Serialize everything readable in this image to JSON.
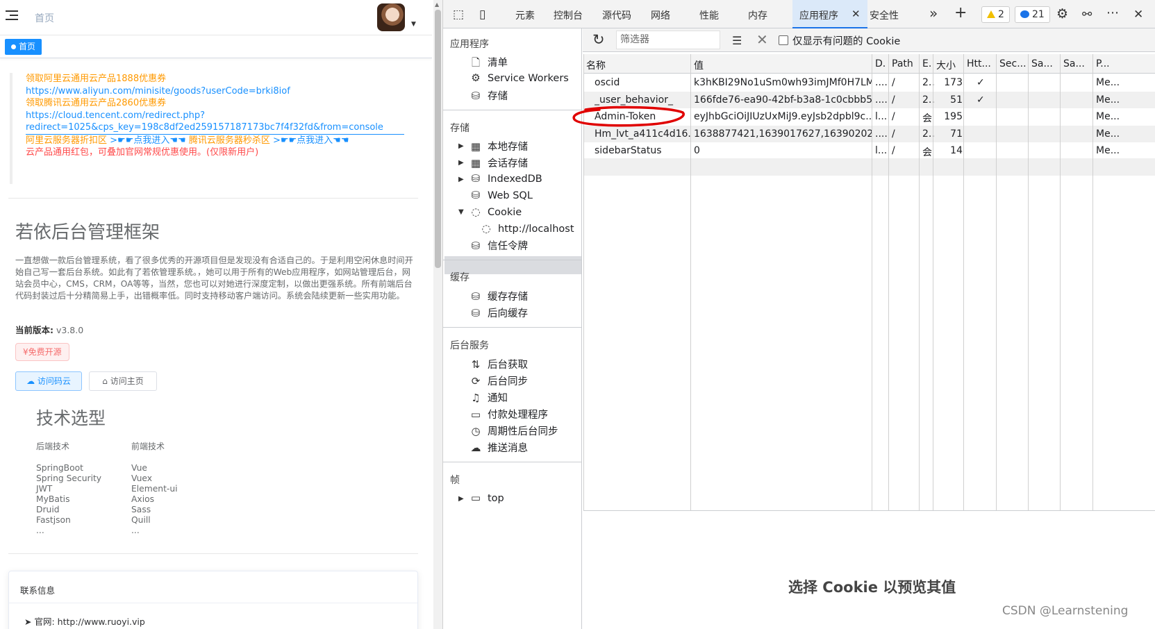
{
  "app": {
    "breadcrumb_home": "首页",
    "tag_home": "首页",
    "promo": {
      "line1": "领取阿里云通用云产品1888优惠券",
      "line2": "https://www.aliyun.com/minisite/goods?userCode=brki8iof",
      "line3": "领取腾讯云通用云产品2860优惠券",
      "line4": "https://cloud.tencent.com/redirect.php?",
      "line5": "redirect=1025&cps_key=198c8df2ed259157187173bc7f4f32fd&from=console",
      "line6_a": "阿里云服务器折扣区",
      "line6_b": ">☛☛点我进入☚☚",
      "line6_c": "腾讯云服务器秒杀区",
      "line6_d": ">☛☛点我进入☚☚",
      "line7": "云产品通用红包，可叠加官网常规优惠使用。(仅限新用户)"
    },
    "title": "若依后台管理框架",
    "description": "一直想做一款后台管理系统，看了很多优秀的开源项目但是发现没有合适自己的。于是利用空闲休息时间开始自己写一套后台系统。如此有了若依管理系统。，她可以用于所有的Web应用程序，如网站管理后台，网站会员中心，CMS，CRM，OA等等，当然，您也可以对她进行深度定制，以做出更强系统。所有前端后台代码封装过后十分精简易上手，出错概率低。同时支持移动客户端访问。系统会陆续更新一些实用功能。",
    "version_label": "当前版本:",
    "version_value": "v3.8.0",
    "free_tag": "¥免费开源",
    "btn_cloud": "访问码云",
    "btn_home": "访问主页",
    "tech_title": "技术选型",
    "backend_label": "后端技术",
    "frontend_label": "前端技术",
    "backend": [
      "SpringBoot",
      "Spring Security",
      "JWT",
      "MyBatis",
      "Druid",
      "Fastjson",
      "..."
    ],
    "frontend": [
      "Vue",
      "Vuex",
      "Element-ui",
      "Axios",
      "Sass",
      "Quill",
      "..."
    ],
    "contact_title": "联系信息",
    "contact_site_label": "官网:",
    "contact_site_value": "http://www.ruoyi.vip"
  },
  "devtools": {
    "tabs": [
      "元素",
      "控制台",
      "源代码",
      "网络",
      "性能",
      "内存",
      "应用程序",
      "安全性"
    ],
    "active_tab": "应用程序",
    "warnings": "2",
    "messages": "21",
    "sidebar": {
      "app_title": "应用程序",
      "app_items": [
        "清单",
        "Service Workers",
        "存储"
      ],
      "storage_title": "存储",
      "storage_items": [
        "本地存储",
        "会话存储",
        "IndexedDB",
        "Web SQL",
        "Cookie"
      ],
      "cookie_child": "http://localhost",
      "trust_tokens": "信任令牌",
      "cache_title": "缓存",
      "cache_items": [
        "缓存存储",
        "后向缓存"
      ],
      "bg_title": "后台服务",
      "bg_items": [
        "后台获取",
        "后台同步",
        "通知",
        "付款处理程序",
        "周期性后台同步",
        "推送消息"
      ],
      "frames_title": "帧",
      "frames_item": "top"
    },
    "toolbar": {
      "filter_placeholder": "筛选器",
      "only_issues_label": "仅显示有问题的 Cookie"
    },
    "columns": [
      "名称",
      "值",
      "D.",
      "Path",
      "E.",
      "大小",
      "Htt...",
      "Sec...",
      "Sa...",
      "Sa...",
      "P..."
    ],
    "rows": [
      {
        "name": "oscid",
        "value": "k3hKBI29No1uSm0wh93imJMf0H7LM...",
        "domain": "....",
        "path": "/",
        "expires": "2..",
        "size": "173",
        "http": "✓",
        "priority": "Me..."
      },
      {
        "name": "_user_behavior_",
        "value": "166fde76-ea90-42bf-b3a8-1c0cbbb58...",
        "domain": "....",
        "path": "/",
        "expires": "2..",
        "size": "51",
        "http": "✓",
        "priority": "Me..."
      },
      {
        "name": "Admin-Token",
        "value": "eyJhbGciOiJIUzUxMiJ9.eyJsb2dpbl9c...",
        "domain": "l...",
        "path": "/",
        "expires": "会",
        "size": "195",
        "http": "",
        "priority": "Me..."
      },
      {
        "name": "Hm_lvt_a411c4d16...",
        "value": "1638877421,1639017627,1639020218",
        "domain": "....",
        "path": "/",
        "expires": "2..",
        "size": "71",
        "http": "",
        "priority": "Me..."
      },
      {
        "name": "sidebarStatus",
        "value": "0",
        "domain": "l...",
        "path": "/",
        "expires": "会",
        "size": "14",
        "http": "",
        "priority": "Me..."
      }
    ],
    "preview_text": "选择 Cookie 以预览其值"
  },
  "watermark": "CSDN @Learnstening",
  "colors": {
    "accent": "#1890ff",
    "annotation": "#e00000",
    "devtools_active": "#1a73e8"
  }
}
